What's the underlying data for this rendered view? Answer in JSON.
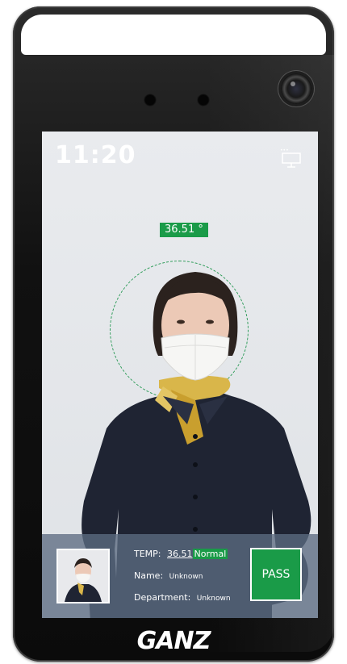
{
  "screen": {
    "clock": "11:20",
    "temperature_readout": "36.51 °",
    "info": {
      "temp_label": "TEMP:",
      "temp_value": "36.51",
      "temp_status": "Normal",
      "name_label": "Name:",
      "name_value": "Unknown",
      "department_label": "Department:",
      "department_value": "Unknown",
      "pass_label": "PASS"
    },
    "icons": {
      "network": "network-monitor-icon"
    }
  },
  "device": {
    "brand": "GANZ"
  },
  "colors": {
    "status_green": "#1a9b48",
    "panel_overlay": "#5c6c82",
    "screen_bg": "#e4e7eb",
    "bezel": "#111111"
  }
}
